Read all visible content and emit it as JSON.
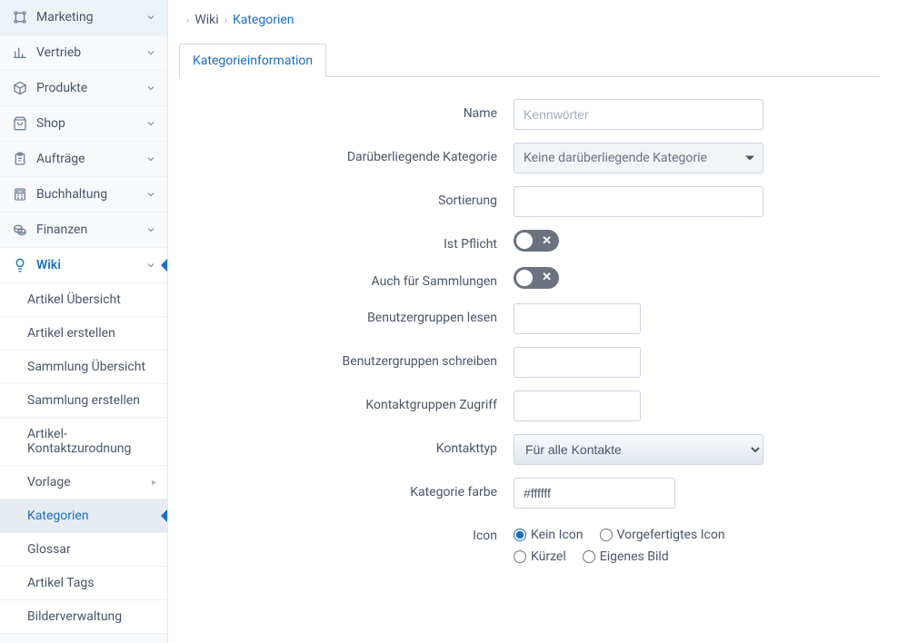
{
  "sidebar": {
    "items": [
      {
        "icon": "network-icon",
        "label": "Marketing"
      },
      {
        "icon": "bar-chart-icon",
        "label": "Vertrieb"
      },
      {
        "icon": "cube-icon",
        "label": "Produkte"
      },
      {
        "icon": "shopping-bag-icon",
        "label": "Shop"
      },
      {
        "icon": "clipboard-icon",
        "label": "Aufträge"
      },
      {
        "icon": "calculator-icon",
        "label": "Buchhaltung"
      },
      {
        "icon": "coins-icon",
        "label": "Finanzen"
      },
      {
        "icon": "lightbulb-icon",
        "label": "Wiki"
      }
    ],
    "subitems": [
      {
        "label": "Artikel Übersicht"
      },
      {
        "label": "Artikel erstellen"
      },
      {
        "label": "Sammlung Übersicht"
      },
      {
        "label": "Sammlung erstellen"
      },
      {
        "label": "Artikel-Kontaktzurodnung"
      },
      {
        "label": "Vorlage",
        "has_sub": true
      },
      {
        "label": "Kategorien",
        "selected": true
      },
      {
        "label": "Glossar"
      },
      {
        "label": "Artikel Tags"
      },
      {
        "label": "Bilderverwaltung"
      }
    ]
  },
  "breadcrumb": {
    "part1": "Wiki",
    "part2": "Kategorien"
  },
  "tabs": {
    "tab1": "Kategorieinformation"
  },
  "form": {
    "name_label": "Name",
    "name_placeholder": "Kennwörter",
    "parent_label": "Darüberliegende Kategorie",
    "parent_value": "Keine darüberliegende Kategorie",
    "sort_label": "Sortierung",
    "sort_value": "",
    "required_label": "Ist Pflicht",
    "collections_label": "Auch für Sammlungen",
    "read_groups_label": "Benutzergruppen lesen",
    "write_groups_label": "Benutzergruppen schreiben",
    "contact_groups_label": "Kontaktgruppen Zugriff",
    "contact_type_label": "Kontakttyp",
    "contact_type_value": "Für alle Kontakte",
    "color_label": "Kategorie farbe",
    "color_value": "#ffffff",
    "icon_label": "Icon",
    "icon_options": {
      "opt1": "Kein Icon",
      "opt2": "Vorgefertigtes Icon",
      "opt3": "Kürzel",
      "opt4": "Eigenes Bild"
    }
  }
}
